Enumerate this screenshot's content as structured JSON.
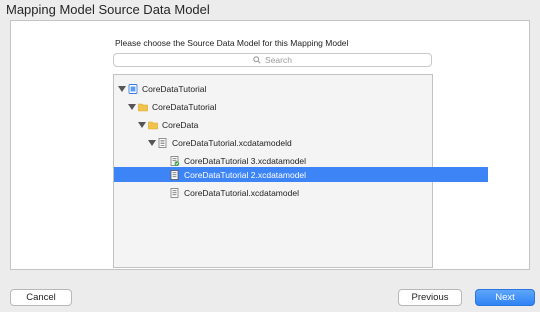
{
  "window": {
    "title": "Mapping Model Source Data Model"
  },
  "dialog": {
    "instruction": "Please choose the Source Data Model for this Mapping Model",
    "search_placeholder": "Search"
  },
  "tree": [
    {
      "label": "CoreDataTutorial",
      "icon": "project-icon",
      "expanded": true
    },
    {
      "label": "CoreDataTutorial",
      "icon": "folder-icon",
      "expanded": true
    },
    {
      "label": "CoreData",
      "icon": "folder-icon",
      "expanded": true
    },
    {
      "label": "CoreDataTutorial.xcdatamodeld",
      "icon": "data-model-bundle-icon",
      "expanded": true
    },
    {
      "label": "CoreDataTutorial 3.xcdatamodel",
      "icon": "current-model-file-icon",
      "current": true
    },
    {
      "label": "CoreDataTutorial 2.xcdatamodel",
      "icon": "model-file-icon",
      "selected": true
    },
    {
      "label": "CoreDataTutorial.xcdatamodel",
      "icon": "model-file-icon"
    }
  ],
  "buttons": {
    "cancel": "Cancel",
    "previous": "Previous",
    "next": "Next"
  },
  "colors": {
    "selection": "#3d84f6",
    "folder": "#f2c34a",
    "accent_button": "#2f82f4"
  }
}
